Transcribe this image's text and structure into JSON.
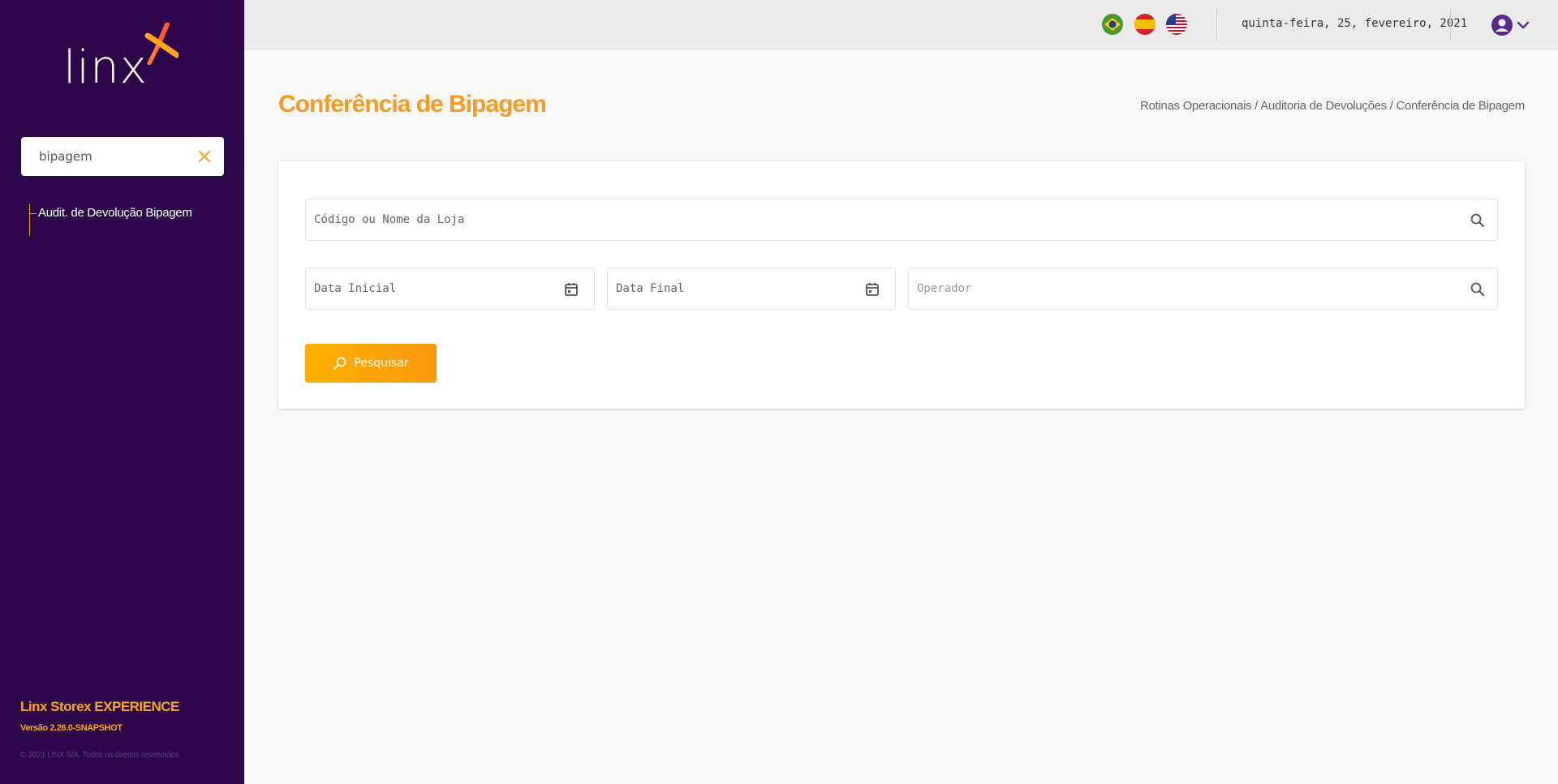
{
  "brand": {
    "logo_text": "linx",
    "logo_icon": "linx-x-logo-icon",
    "accent": "#f59a23",
    "sidebar_bg": "#2c0649"
  },
  "sidebar": {
    "search_value": "bipagem",
    "clear_icon": "close-icon",
    "items": [
      {
        "label": "Audit. de Devolução Bipagem"
      }
    ],
    "app_name": "Linx Storex EXPERIENCE",
    "version": "Versão 2.26.0-SNAPSHOT",
    "copyright": "© 2021 LINX S/A. Todos os direitos reservados"
  },
  "topbar": {
    "languages": [
      {
        "icon": "flag-brazil-icon"
      },
      {
        "icon": "flag-spain-icon"
      },
      {
        "icon": "flag-usa-icon"
      }
    ],
    "date": "quinta-feira, 25, fevereiro, 2021",
    "user_icon": "user-circle-icon",
    "menu_icon": "chevron-down-icon"
  },
  "page": {
    "title": "Conferência de Bipagem",
    "breadcrumb": [
      "Rotinas Operacionais",
      "Auditoria de Devoluções",
      "Conferência de Bipagem"
    ],
    "breadcrumb_sep": "/"
  },
  "form": {
    "store_placeholder": "Código ou Nome da Loja",
    "start_date_placeholder": "Data Inicial",
    "end_date_placeholder": "Data Final",
    "operator_placeholder": "Operador",
    "search_button": "Pesquisar"
  }
}
